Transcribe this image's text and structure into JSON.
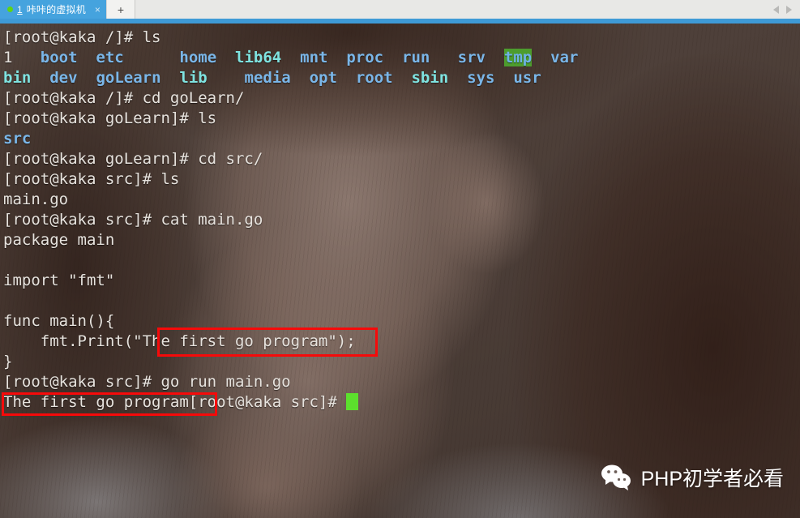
{
  "window": {
    "tab": {
      "status_dot": "green-dot-icon",
      "number": "1",
      "title": "咔咔的虚拟机",
      "close_label": "×"
    },
    "new_tab_label": "+",
    "nav_prev": "prev-arrow-icon",
    "nav_next": "next-arrow-icon"
  },
  "terminal": {
    "lines": [
      {
        "id": "l1",
        "segments": [
          {
            "text": "[root@kaka /]# ls",
            "style": "w"
          }
        ]
      },
      {
        "id": "l2",
        "segments": [
          {
            "text": "1   ",
            "style": "w"
          },
          {
            "text": "boot",
            "style": "dir"
          },
          {
            "text": "  ",
            "style": "w"
          },
          {
            "text": "etc",
            "style": "dir"
          },
          {
            "text": "      ",
            "style": "w"
          },
          {
            "text": "home",
            "style": "dir"
          },
          {
            "text": "  ",
            "style": "w"
          },
          {
            "text": "lib64",
            "style": "lnk"
          },
          {
            "text": "  ",
            "style": "w"
          },
          {
            "text": "mnt",
            "style": "dir"
          },
          {
            "text": "  ",
            "style": "w"
          },
          {
            "text": "proc",
            "style": "dir"
          },
          {
            "text": "  ",
            "style": "w"
          },
          {
            "text": "run",
            "style": "dir"
          },
          {
            "text": "   ",
            "style": "w"
          },
          {
            "text": "srv",
            "style": "dir"
          },
          {
            "text": "  ",
            "style": "w"
          },
          {
            "text": "tmp",
            "style": "tmp"
          },
          {
            "text": "  ",
            "style": "w"
          },
          {
            "text": "var",
            "style": "dir"
          }
        ]
      },
      {
        "id": "l3",
        "segments": [
          {
            "text": "bin",
            "style": "lnk"
          },
          {
            "text": "  ",
            "style": "w"
          },
          {
            "text": "dev",
            "style": "dir"
          },
          {
            "text": "  ",
            "style": "w"
          },
          {
            "text": "goLearn",
            "style": "dir"
          },
          {
            "text": "  ",
            "style": "w"
          },
          {
            "text": "lib",
            "style": "lnk"
          },
          {
            "text": "    ",
            "style": "w"
          },
          {
            "text": "media",
            "style": "dir"
          },
          {
            "text": "  ",
            "style": "w"
          },
          {
            "text": "opt",
            "style": "dir"
          },
          {
            "text": "  ",
            "style": "w"
          },
          {
            "text": "root",
            "style": "dir"
          },
          {
            "text": "  ",
            "style": "w"
          },
          {
            "text": "sbin",
            "style": "lnk"
          },
          {
            "text": "  ",
            "style": "w"
          },
          {
            "text": "sys",
            "style": "dir"
          },
          {
            "text": "  ",
            "style": "w"
          },
          {
            "text": "usr",
            "style": "dir"
          }
        ]
      },
      {
        "id": "l4",
        "segments": [
          {
            "text": "[root@kaka /]# cd goLearn/",
            "style": "w"
          }
        ]
      },
      {
        "id": "l5",
        "segments": [
          {
            "text": "[root@kaka goLearn]# ls",
            "style": "w"
          }
        ]
      },
      {
        "id": "l6",
        "segments": [
          {
            "text": "src",
            "style": "dir"
          }
        ]
      },
      {
        "id": "l7",
        "segments": [
          {
            "text": "[root@kaka goLearn]# cd src/",
            "style": "w"
          }
        ]
      },
      {
        "id": "l8",
        "segments": [
          {
            "text": "[root@kaka src]# ls",
            "style": "w"
          }
        ]
      },
      {
        "id": "l9",
        "segments": [
          {
            "text": "main.go",
            "style": "w"
          }
        ]
      },
      {
        "id": "l10",
        "segments": [
          {
            "text": "[root@kaka src]# cat main.go",
            "style": "w"
          }
        ]
      },
      {
        "id": "l11",
        "segments": [
          {
            "text": "package main",
            "style": "w"
          }
        ]
      },
      {
        "id": "l12",
        "segments": [
          {
            "text": "",
            "style": "w"
          }
        ]
      },
      {
        "id": "l13",
        "segments": [
          {
            "text": "import \"fmt\"",
            "style": "w"
          }
        ]
      },
      {
        "id": "l14",
        "segments": [
          {
            "text": "",
            "style": "w"
          }
        ]
      },
      {
        "id": "l15",
        "segments": [
          {
            "text": "func main(){",
            "style": "w"
          }
        ]
      },
      {
        "id": "l16",
        "segments": [
          {
            "text": "    fmt.Print(\"The first go program\");",
            "style": "w"
          }
        ]
      },
      {
        "id": "l17",
        "segments": [
          {
            "text": "}",
            "style": "w"
          }
        ]
      },
      {
        "id": "l18",
        "segments": [
          {
            "text": "[root@kaka src]# go run main.go",
            "style": "w"
          }
        ]
      },
      {
        "id": "l19",
        "segments": [
          {
            "text": "The first go program[root@kaka src]# ",
            "style": "w"
          },
          {
            "text": "",
            "style": "cursor"
          }
        ]
      }
    ]
  },
  "annotations": {
    "box1_label": "highlight-printed-string-in-source",
    "box2_label": "highlight-program-output"
  },
  "watermark": {
    "icon": "wechat-icon",
    "text": "PHP初学者必看"
  },
  "colors": {
    "tab_active": "#45a3de",
    "tab_dot": "#5fd413",
    "blue_strip": "#3e9ad6",
    "annotation_red": "#f60a0a",
    "cursor_green": "#5ce02d",
    "dir_blue": "#7ab6e8",
    "link_cyan": "#7fe3e0",
    "tmp_bg_green": "#4d9c2e",
    "text_white": "#e7e3de"
  }
}
